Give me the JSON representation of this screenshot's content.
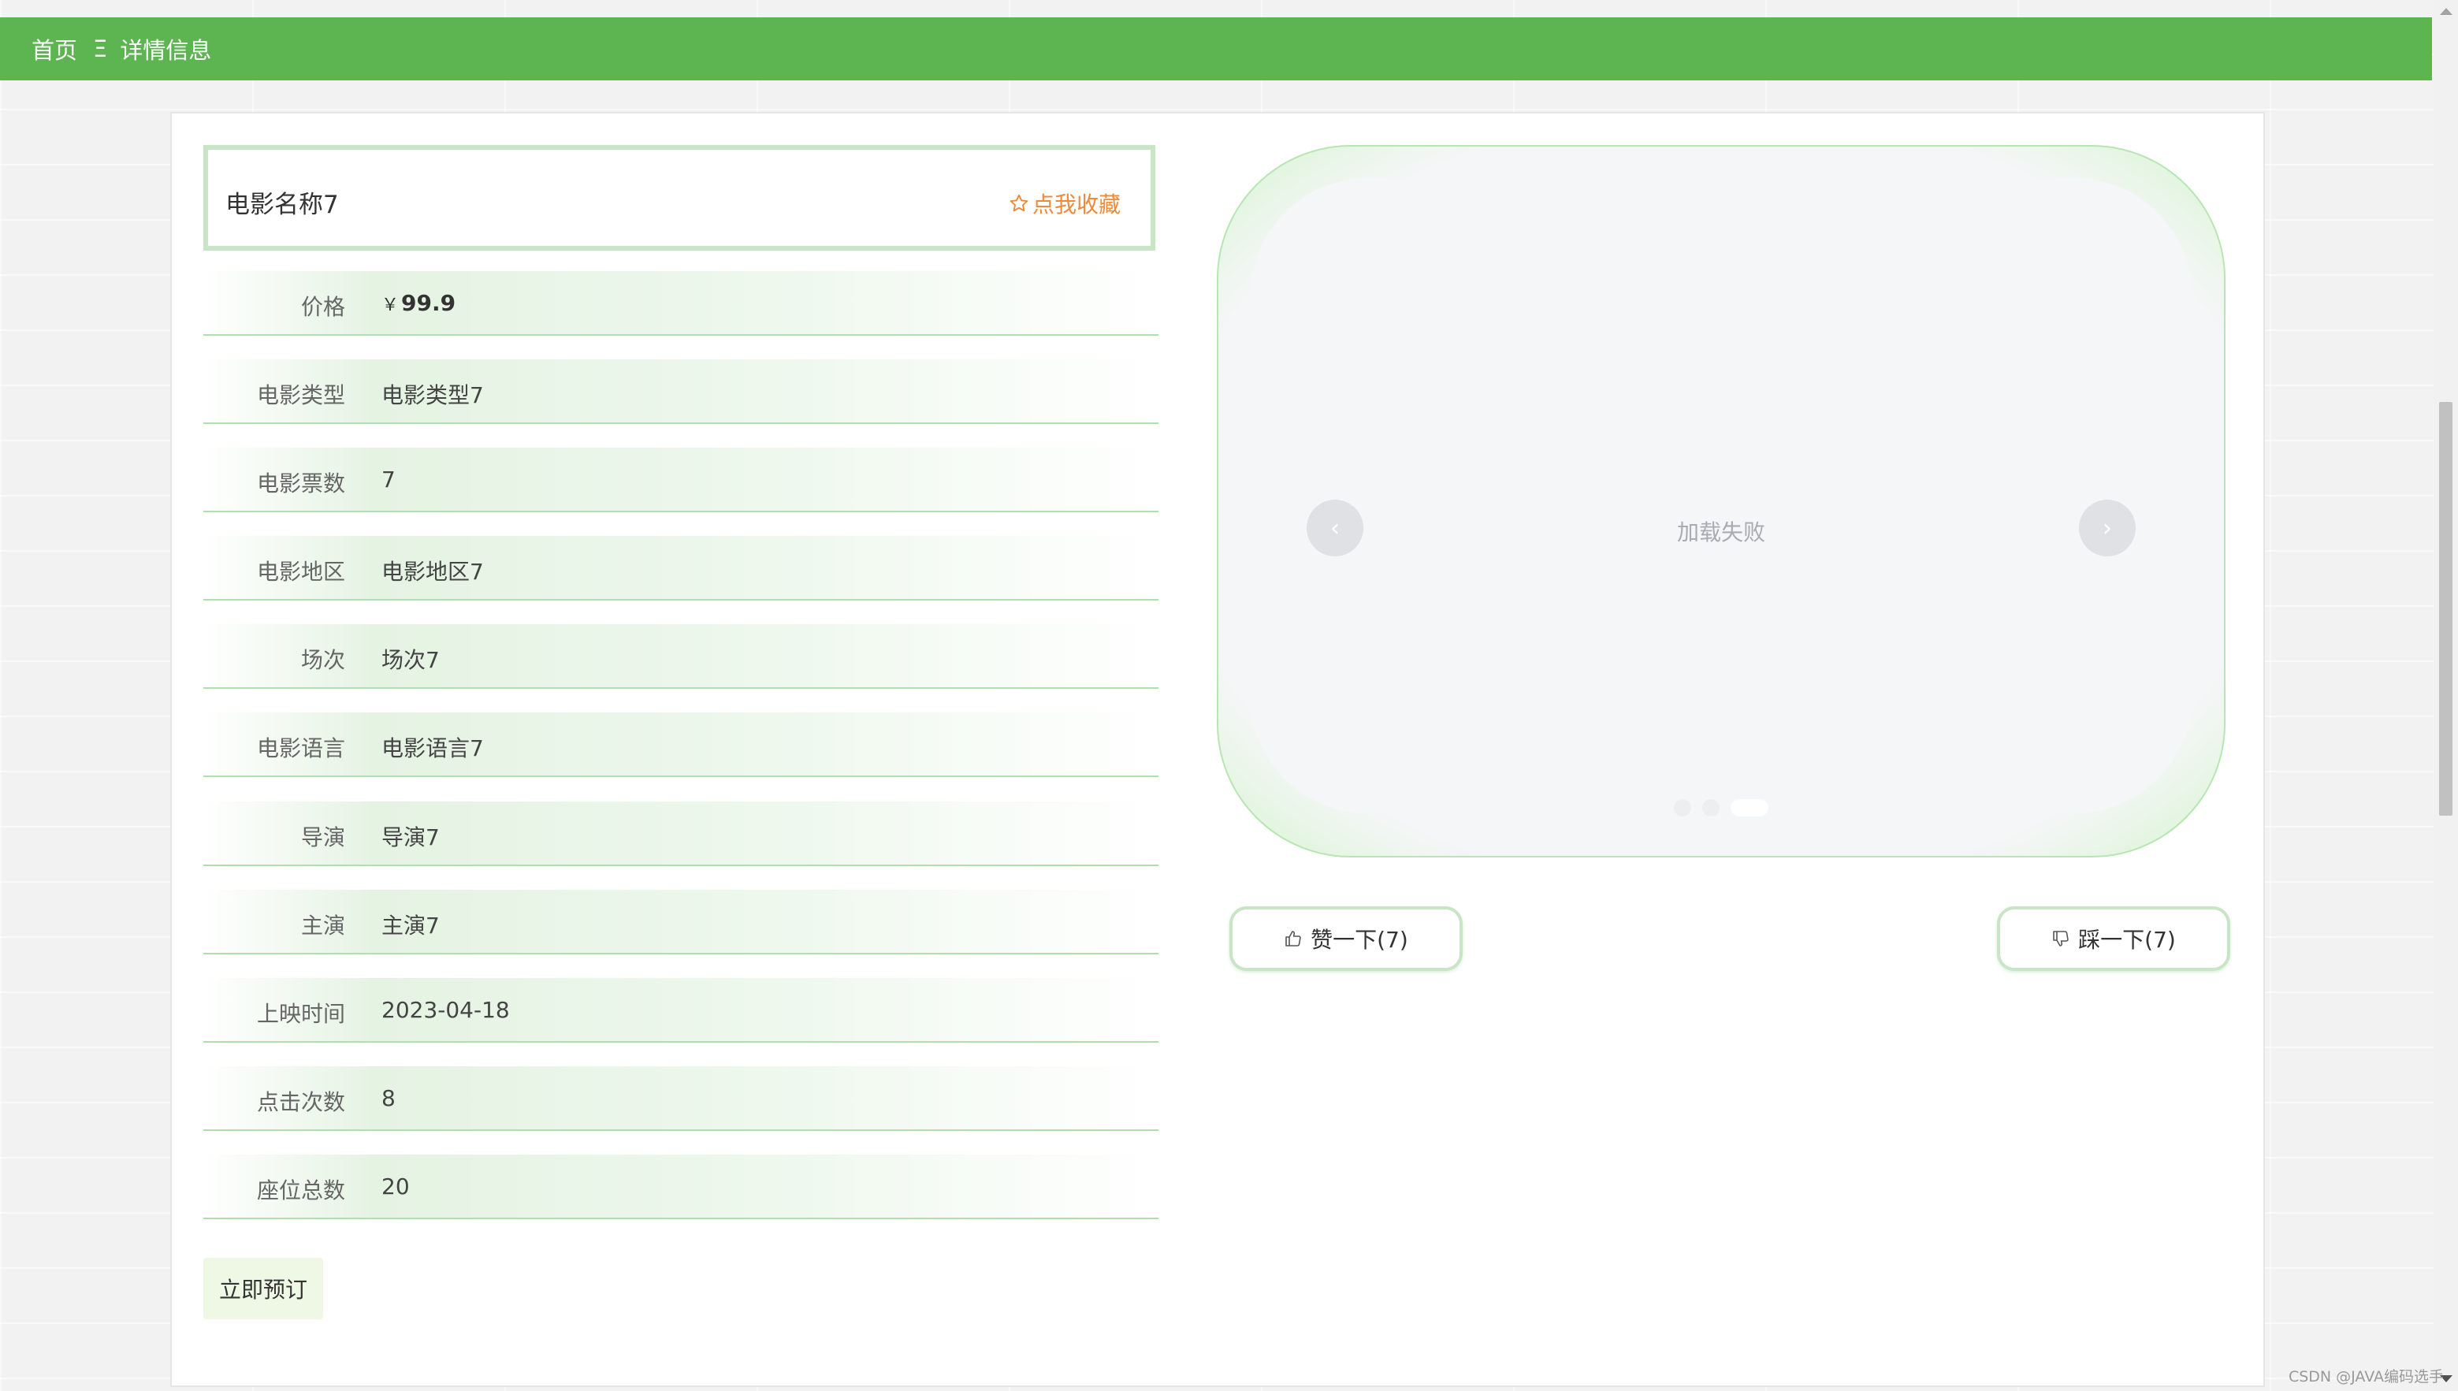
{
  "breadcrumb": {
    "home": "首页",
    "separator": "Ξ",
    "current": "详情信息"
  },
  "movie": {
    "title": "电影名称7",
    "favorite_label": "点我收藏"
  },
  "details": [
    {
      "label": "价格",
      "currency": "￥",
      "value": "99.9"
    },
    {
      "label": "电影类型",
      "value": "电影类型7"
    },
    {
      "label": "电影票数",
      "value": "7"
    },
    {
      "label": "电影地区",
      "value": "电影地区7"
    },
    {
      "label": "场次",
      "value": "场次7"
    },
    {
      "label": "电影语言",
      "value": "电影语言7"
    },
    {
      "label": "导演",
      "value": "导演7"
    },
    {
      "label": "主演",
      "value": "主演7"
    },
    {
      "label": "上映时间",
      "value": "2023-04-18"
    },
    {
      "label": "点击次数",
      "value": "8"
    },
    {
      "label": "座位总数",
      "value": "20"
    }
  ],
  "book_button": "立即预订",
  "carousel": {
    "error_text": "加载失败",
    "prev": "‹",
    "next": "›",
    "slide_count": 3,
    "active_index": 2
  },
  "votes": {
    "like_label": "赞一下(7)",
    "dislike_label": "踩一下(7)"
  },
  "watermark": "CSDN @JAVA编码选手",
  "colors": {
    "header": "#5cb551",
    "favorite": "#ef8a3a",
    "accent_border": "#c8e6c6"
  },
  "icons": {
    "favorite": "star-outline-icon",
    "like": "thumbs-up-icon",
    "dislike": "thumbs-down-icon"
  }
}
